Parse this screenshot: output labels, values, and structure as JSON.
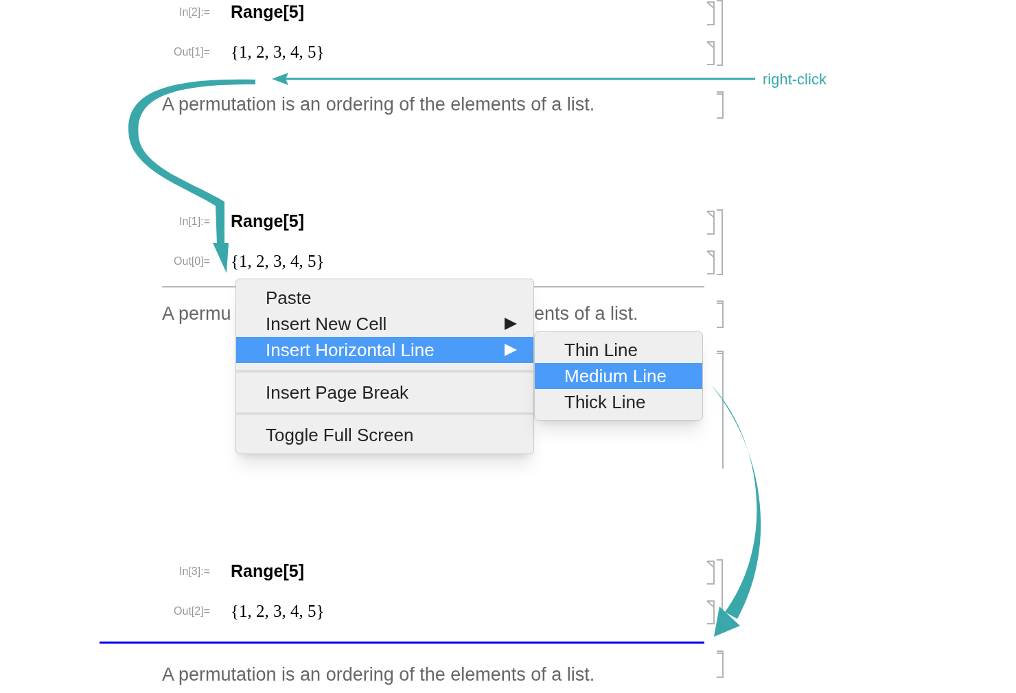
{
  "sections": [
    {
      "input_label": "In[2]:=",
      "input": "Range[5]",
      "output_label": "Out[1]=",
      "output": "{1, 2, 3, 4, 5}",
      "kind": "plain",
      "text_parts": [
        "A permutation is an ordering of the elements of a list."
      ]
    },
    {
      "input_label": "In[1]:=",
      "input": "Range[5]",
      "output_label": "Out[0]=",
      "output": "{1, 2, 3, 4, 5}",
      "kind": "thin_line",
      "text_parts": [
        "A permu",
        "ents of a list."
      ]
    },
    {
      "input_label": "In[3]:=",
      "input": "Range[5]",
      "output_label": "Out[2]=",
      "output": "{1, 2, 3, 4, 5}",
      "kind": "medium_line",
      "text_parts": [
        "A permutation is an ordering of the elements of a list."
      ]
    }
  ],
  "annotation": {
    "label": "right-click"
  },
  "context_menu": {
    "items": [
      {
        "kind": "item",
        "label": "Paste",
        "submenu": false,
        "selected": false
      },
      {
        "kind": "item",
        "label": "Insert New Cell",
        "submenu": true,
        "selected": false
      },
      {
        "kind": "item",
        "label": "Insert Horizontal Line",
        "submenu": true,
        "selected": true
      },
      {
        "kind": "separator"
      },
      {
        "kind": "item",
        "label": "Insert Page Break",
        "submenu": false,
        "selected": false
      },
      {
        "kind": "separator"
      },
      {
        "kind": "item",
        "label": "Toggle Full Screen",
        "submenu": false,
        "selected": false
      }
    ]
  },
  "submenu": {
    "items": [
      {
        "label": "Thin Line",
        "selected": false
      },
      {
        "label": "Medium Line",
        "selected": true
      },
      {
        "label": "Thick Line",
        "selected": false
      }
    ]
  }
}
